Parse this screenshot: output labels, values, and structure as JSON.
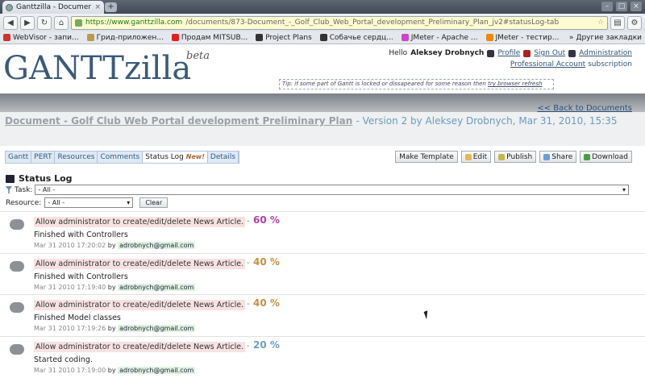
{
  "browser": {
    "tab_title": "Ganttzilla - Documen...",
    "tab_close": "×",
    "new_tab": "+",
    "url_domain": "https://www.ganttzilla.com",
    "url_path": "/documents/873-Document_-_Golf_Club_Web_Portal_development_Preliminary_Plan_jv2#statusLog-tab",
    "bookmarks": [
      {
        "label": "WebVisor - запи...",
        "color": "#c33"
      },
      {
        "label": "Грид-приложен...",
        "color": "#b95"
      },
      {
        "label": "Продам MITSUB...",
        "color": "#d22"
      },
      {
        "label": "Project Plans",
        "color": "#333"
      },
      {
        "label": "Собачье сердц...",
        "color": "#333"
      },
      {
        "label": "JMeter - Apache ...",
        "color": "#c4c"
      },
      {
        "label": "JMeter - тестир...",
        "color": "#e80"
      }
    ],
    "bookmarks_more": "Другие закладки"
  },
  "header": {
    "logo": "GANTTzilla",
    "logo_beta": "beta",
    "hello": "Hello",
    "user_name": "Aleksey Drobnych",
    "profile": "Profile",
    "sign_out": "Sign Out",
    "administration": "Administration",
    "professional_account": "Professional Account",
    "subscription": "subscription",
    "tip": "Tip: if some part of Gantt is locked or dissapeared for some reason then",
    "tip_link": "try browser refresh",
    "back_link": "<< Back to Documents"
  },
  "document": {
    "title": "Document - Golf Club Web Portal development Preliminary Plan",
    "version": "- Version 2 by Aleksey Drobnych, Mar 31, 2010, 15:35"
  },
  "view_tabs": [
    {
      "label": "Gantt"
    },
    {
      "label": "PERT"
    },
    {
      "label": "Resources"
    },
    {
      "label": "Comments"
    },
    {
      "label": "Status Log",
      "badge": "New!"
    },
    {
      "label": "Details"
    }
  ],
  "actions": {
    "make_template": "Make Template",
    "edit": "Edit",
    "publish": "Publish",
    "share": "Share",
    "download": "Download"
  },
  "status_log": {
    "title": "Status Log",
    "task_label": "Task:",
    "task_value": "- All -",
    "resource_label": "Resource:",
    "resource_value": "- All -",
    "clear": "Clear",
    "separator": "-",
    "by": "by",
    "entries": [
      {
        "task": "Allow administrator to create/edit/delete News Article.",
        "percent": "60 %",
        "color": "#b03fa8",
        "message": "Finished with Controllers",
        "date": "Mar 31 2010 17:20:02",
        "email": "adrobnych@gmail.com"
      },
      {
        "task": "Allow administrator to create/edit/delete News Article.",
        "percent": "40 %",
        "color": "#c39243",
        "message": "Finished with Controllers",
        "date": "Mar 31 2010 17:19:40",
        "email": "adrobnych@gmail.com"
      },
      {
        "task": "Allow administrator to create/edit/delete News Article.",
        "percent": "40 %",
        "color": "#c39243",
        "message": "Finished Model classes",
        "date": "Mar 31 2010 17:19:26",
        "email": "adrobnych@gmail.com"
      },
      {
        "task": "Allow administrator to create/edit/delete News Article.",
        "percent": "20 %",
        "color": "#6c9dc7",
        "message": "Started coding.",
        "date": "Mar 31 2010 17:19:00",
        "email": "adrobnych@gmail.com"
      }
    ]
  }
}
